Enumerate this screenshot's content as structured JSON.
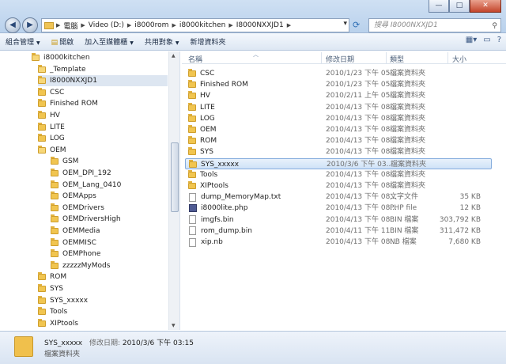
{
  "window": {
    "minimize": "—",
    "maximize": "□",
    "close": "✕"
  },
  "address": {
    "segments": [
      "電腦",
      "Video (D:)",
      "i8000rom",
      "i8000kitchen",
      "I8000NXXJD1"
    ]
  },
  "search": {
    "placeholder": "搜尋 I8000NXXJD1"
  },
  "toolbar": {
    "organize": "組合管理",
    "open": "開啟",
    "add_to_library": "加入至媒體櫃",
    "share": "共用對象",
    "new_folder": "新增資料夾"
  },
  "tree": [
    {
      "label": "i8000kitchen",
      "level": 0
    },
    {
      "label": "_Template",
      "level": 1
    },
    {
      "label": "I8000NXXJD1",
      "level": 1,
      "selected": true
    },
    {
      "label": "CSC",
      "level": 2
    },
    {
      "label": "Finished ROM",
      "level": 2
    },
    {
      "label": "HV",
      "level": 2
    },
    {
      "label": "LITE",
      "level": 2
    },
    {
      "label": "LOG",
      "level": 2
    },
    {
      "label": "OEM",
      "level": 2
    },
    {
      "label": "GSM",
      "level": 3
    },
    {
      "label": "OEM_DPI_192",
      "level": 3
    },
    {
      "label": "OEM_Lang_0410",
      "level": 3
    },
    {
      "label": "OEMApps",
      "level": 3
    },
    {
      "label": "OEMDrivers",
      "level": 3
    },
    {
      "label": "OEMDriversHigh",
      "level": 3
    },
    {
      "label": "OEMMedia",
      "level": 3
    },
    {
      "label": "OEMMISC",
      "level": 3
    },
    {
      "label": "OEMPhone",
      "level": 3
    },
    {
      "label": "zzzzzMyMods",
      "level": 3
    },
    {
      "label": "ROM",
      "level": 2
    },
    {
      "label": "SYS",
      "level": 2
    },
    {
      "label": "SYS_xxxxx",
      "level": 2
    },
    {
      "label": "Tools",
      "level": 2
    },
    {
      "label": "XIPtools",
      "level": 2
    }
  ],
  "columns": {
    "name": "名稱",
    "date": "修改日期",
    "type": "類型",
    "size": "大小"
  },
  "files": [
    {
      "name": "CSC",
      "date": "2010/1/23 下午 05...",
      "type": "檔案資料夾",
      "size": "",
      "icon": "folder"
    },
    {
      "name": "Finished ROM",
      "date": "2010/1/23 下午 05...",
      "type": "檔案資料夾",
      "size": "",
      "icon": "folder"
    },
    {
      "name": "HV",
      "date": "2010/2/11 上午 05...",
      "type": "檔案資料夾",
      "size": "",
      "icon": "folder"
    },
    {
      "name": "LITE",
      "date": "2010/4/13 下午 08...",
      "type": "檔案資料夾",
      "size": "",
      "icon": "folder"
    },
    {
      "name": "LOG",
      "date": "2010/4/13 下午 08...",
      "type": "檔案資料夾",
      "size": "",
      "icon": "folder"
    },
    {
      "name": "OEM",
      "date": "2010/4/13 下午 08...",
      "type": "檔案資料夾",
      "size": "",
      "icon": "folder"
    },
    {
      "name": "ROM",
      "date": "2010/4/13 下午 08...",
      "type": "檔案資料夾",
      "size": "",
      "icon": "folder"
    },
    {
      "name": "SYS",
      "date": "2010/4/13 下午 08...",
      "type": "檔案資料夾",
      "size": "",
      "icon": "folder"
    },
    {
      "name": "SYS_xxxxx",
      "date": "2010/3/6 下午 03...",
      "type": "檔案資料夾",
      "size": "",
      "icon": "folder",
      "selected": true
    },
    {
      "name": "Tools",
      "date": "2010/4/13 下午 08...",
      "type": "檔案資料夾",
      "size": "",
      "icon": "folder"
    },
    {
      "name": "XIPtools",
      "date": "2010/4/13 下午 08...",
      "type": "檔案資料夾",
      "size": "",
      "icon": "folder"
    },
    {
      "name": "dump_MemoryMap.txt",
      "date": "2010/4/13 下午 08...",
      "type": "文字文件",
      "size": "35 KB",
      "icon": "file"
    },
    {
      "name": "i8000lite.php",
      "date": "2010/4/13 下午 08...",
      "type": "PHP file",
      "size": "12 KB",
      "icon": "php"
    },
    {
      "name": "imgfs.bin",
      "date": "2010/4/13 下午 08...",
      "type": "BIN 檔案",
      "size": "303,792 KB",
      "icon": "file"
    },
    {
      "name": "rom_dump.bin",
      "date": "2010/4/11 下午 11...",
      "type": "BIN 檔案",
      "size": "311,472 KB",
      "icon": "file"
    },
    {
      "name": "xip.nb",
      "date": "2010/4/13 下午 08...",
      "type": "NB 檔案",
      "size": "7,680 KB",
      "icon": "file"
    }
  ],
  "details": {
    "name": "SYS_xxxxx",
    "modified_label": "修改日期:",
    "modified_value": "2010/3/6 下午 03:15",
    "type": "檔案資料夾"
  }
}
